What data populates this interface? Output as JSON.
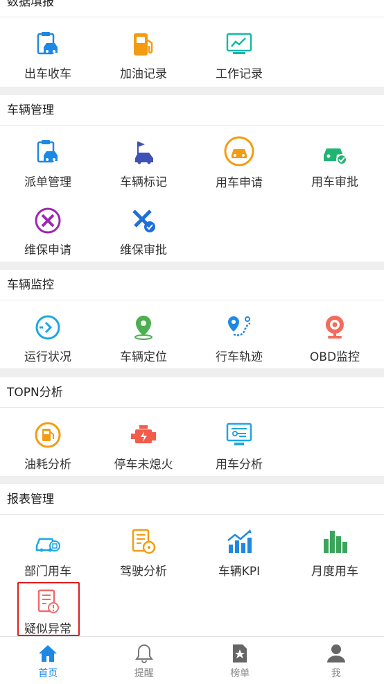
{
  "sections": [
    {
      "title": "数据填报",
      "items": [
        {
          "label": "出车收车",
          "icon": "car-clipboard-icon"
        },
        {
          "label": "加油记录",
          "icon": "fuel-pump-icon"
        },
        {
          "label": "工作记录",
          "icon": "monitor-chart-icon"
        }
      ]
    },
    {
      "title": "车辆管理",
      "items": [
        {
          "label": "派单管理",
          "icon": "car-clipboard-icon"
        },
        {
          "label": "车辆标记",
          "icon": "car-flag-icon"
        },
        {
          "label": "用车申请",
          "icon": "car-circle-icon"
        },
        {
          "label": "用车审批",
          "icon": "car-check-icon"
        },
        {
          "label": "维保申请",
          "icon": "tools-circle-icon"
        },
        {
          "label": "维保审批",
          "icon": "tools-check-icon"
        }
      ]
    },
    {
      "title": "车辆监控",
      "items": [
        {
          "label": "运行状况",
          "icon": "run-status-icon"
        },
        {
          "label": "车辆定位",
          "icon": "location-pin-icon"
        },
        {
          "label": "行车轨迹",
          "icon": "track-route-icon"
        },
        {
          "label": "OBD监控",
          "icon": "camera-monitor-icon"
        }
      ]
    },
    {
      "title": "TOPN分析",
      "items": [
        {
          "label": "油耗分析",
          "icon": "fuel-circle-icon"
        },
        {
          "label": "停车未熄火",
          "icon": "engine-icon"
        },
        {
          "label": "用车分析",
          "icon": "screen-analysis-icon"
        }
      ]
    },
    {
      "title": "报表管理",
      "items": [
        {
          "label": "部门用车",
          "icon": "dept-car-icon"
        },
        {
          "label": "驾驶分析",
          "icon": "driving-report-icon"
        },
        {
          "label": "车辆KPI",
          "icon": "kpi-chart-icon"
        },
        {
          "label": "月度用车",
          "icon": "bar-chart-icon"
        },
        {
          "label": "疑似异常",
          "icon": "abnormal-doc-icon"
        }
      ]
    }
  ],
  "tabs": [
    {
      "label": "首页",
      "icon": "home-icon",
      "active": true
    },
    {
      "label": "提醒",
      "icon": "bell-icon",
      "active": false
    },
    {
      "label": "榜单",
      "icon": "star-doc-icon",
      "active": false
    },
    {
      "label": "我",
      "icon": "user-icon",
      "active": false
    }
  ],
  "colors": {
    "accent": "#1e88e5",
    "highlight": "#e11c1c"
  }
}
